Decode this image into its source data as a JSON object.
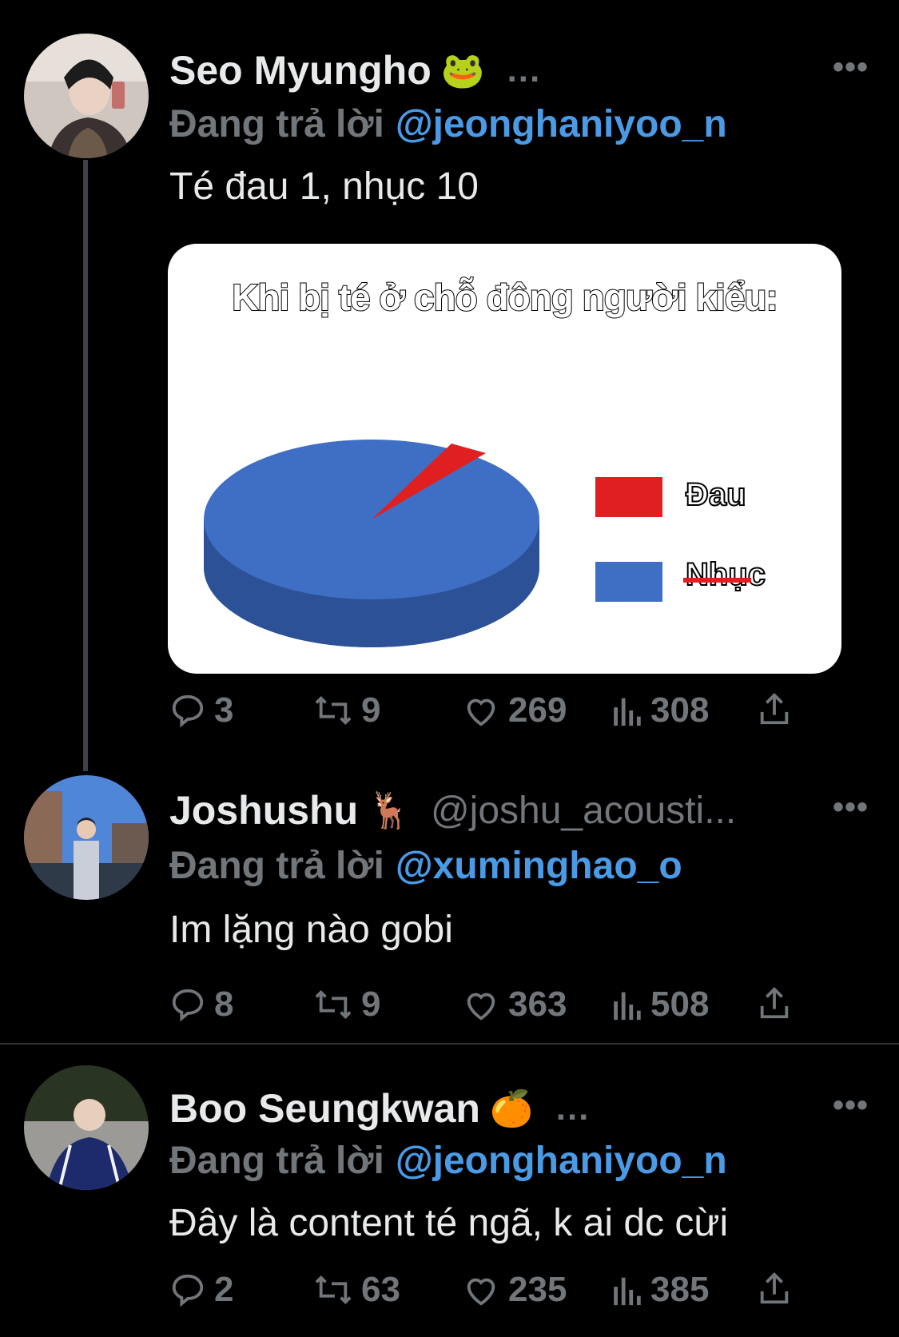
{
  "tweets": [
    {
      "name": "Seo Myungho",
      "emoji": "🐸",
      "handle": "",
      "dots": "...",
      "more": "•••",
      "reply_label": "Đang trả lời",
      "reply_mention": "@jeonghaniyoo_n",
      "text": "Té đau 1, nhục 10",
      "replies": "3",
      "retweets": "9",
      "likes": "269",
      "views": "308"
    },
    {
      "name": "Joshushu",
      "emoji": "🦌",
      "handle": "@joshu_acousti...",
      "dots": "",
      "more": "•••",
      "reply_label": "Đang trả lời",
      "reply_mention": "@xuminghao_o",
      "text": "Im lặng nào gobi",
      "replies": "8",
      "retweets": "9",
      "likes": "363",
      "views": "508"
    },
    {
      "name": "Boo Seungkwan",
      "emoji": "🍊",
      "handle": "",
      "dots": "...",
      "more": "•••",
      "reply_label": "Đang trả lời",
      "reply_mention": "@jeonghaniyoo_n",
      "text": "Đây là content té ngã, k ai dc cừi",
      "replies": "2",
      "retweets": "63",
      "likes": "235",
      "views": "385"
    }
  ],
  "meme": {
    "title": "Khi bị té ở chỗ đông người kiểu:",
    "legend": [
      "Đau",
      "Nhục"
    ],
    "colors": {
      "dau": "#e02020",
      "nhuc": "#3f6ec5"
    }
  },
  "chart_data": {
    "type": "pie",
    "title": "Khi bị té ở chỗ đông người kiểu:",
    "categories": [
      "Đau",
      "Nhục"
    ],
    "values": [
      1,
      10
    ],
    "legend_position": "right"
  },
  "icons": [
    "reply-icon",
    "retweet-icon",
    "like-icon",
    "views-icon",
    "share-icon",
    "more-icon"
  ]
}
